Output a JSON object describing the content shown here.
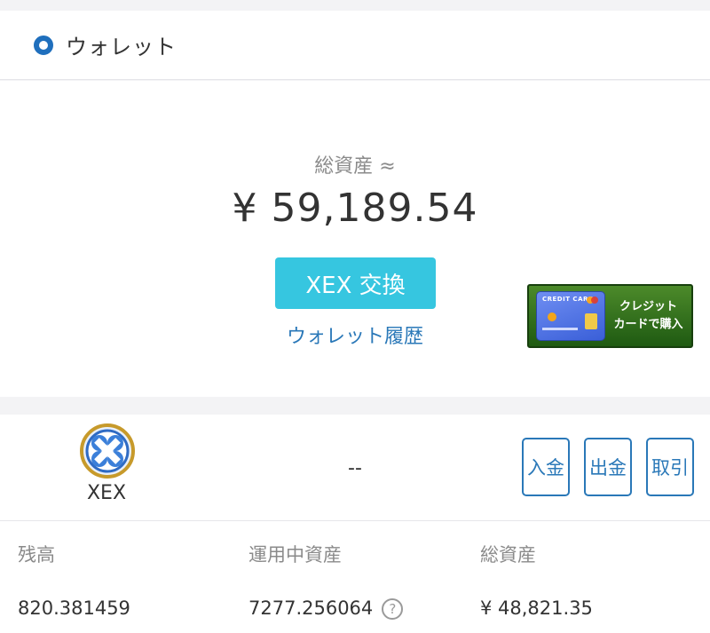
{
  "header": {
    "title": "ウォレット",
    "icon": "wallet-ring-icon"
  },
  "summary": {
    "total_label": "総資産 ≈",
    "total_amount": "¥ 59,189.54",
    "exchange_button": "XEX 交換",
    "history_link": "ウォレット履歴"
  },
  "banner": {
    "card_text": "CREDIT CARD",
    "label_line1": "クレジット",
    "label_line2": "カードで購入"
  },
  "coin": {
    "name": "XEX",
    "logo_icon": "xex-logo-icon",
    "value": "--",
    "actions": {
      "deposit": "入金",
      "withdraw": "出金",
      "trade": "取引"
    }
  },
  "stats": {
    "headers": [
      "残高",
      "運用中資産",
      "総資産"
    ],
    "balance": "820.381459",
    "in_operation": "7277.256064",
    "help_icon": "?",
    "total": "¥ 48,821.35"
  },
  "colors": {
    "accent": "#36c6e0",
    "link": "#2a78b8",
    "ring": "#1f6fbd"
  }
}
